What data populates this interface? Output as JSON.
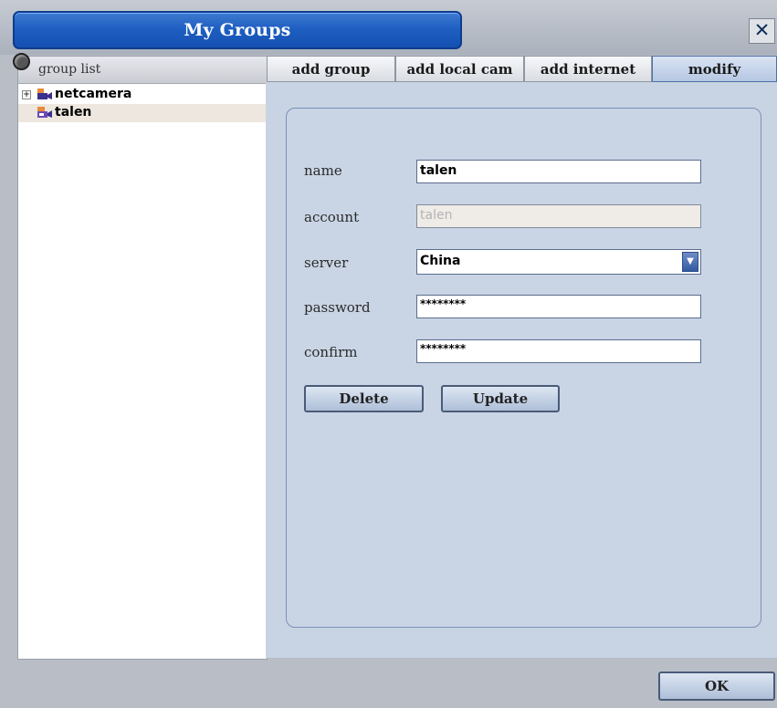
{
  "window": {
    "title": "My Groups",
    "close_glyph": "✕"
  },
  "left": {
    "header_label": "group list",
    "tree": [
      {
        "label": "netcamera",
        "expander": "+",
        "icon": "camera-group-icon"
      },
      {
        "label": "talen",
        "icon": "camera-user-icon",
        "selected": true
      }
    ]
  },
  "tabs": [
    {
      "label": "add group"
    },
    {
      "label": "add local cam"
    },
    {
      "label": "add internet cam"
    },
    {
      "label": "modify attribute",
      "active": true
    }
  ],
  "form": {
    "name": {
      "label": "name",
      "value": "talen"
    },
    "account": {
      "label": "account",
      "value": "talen"
    },
    "server": {
      "label": "server",
      "value": "China"
    },
    "password": {
      "label": "password",
      "value": "********"
    },
    "confirm": {
      "label": "confirm",
      "value": "********"
    }
  },
  "buttons": {
    "delete": "Delete",
    "update": "Update",
    "ok": "OK"
  },
  "colors": {
    "title_bar": "#1f5fc2",
    "active_tab": "#b6c7e2",
    "content_bg": "#c8d4e4"
  }
}
